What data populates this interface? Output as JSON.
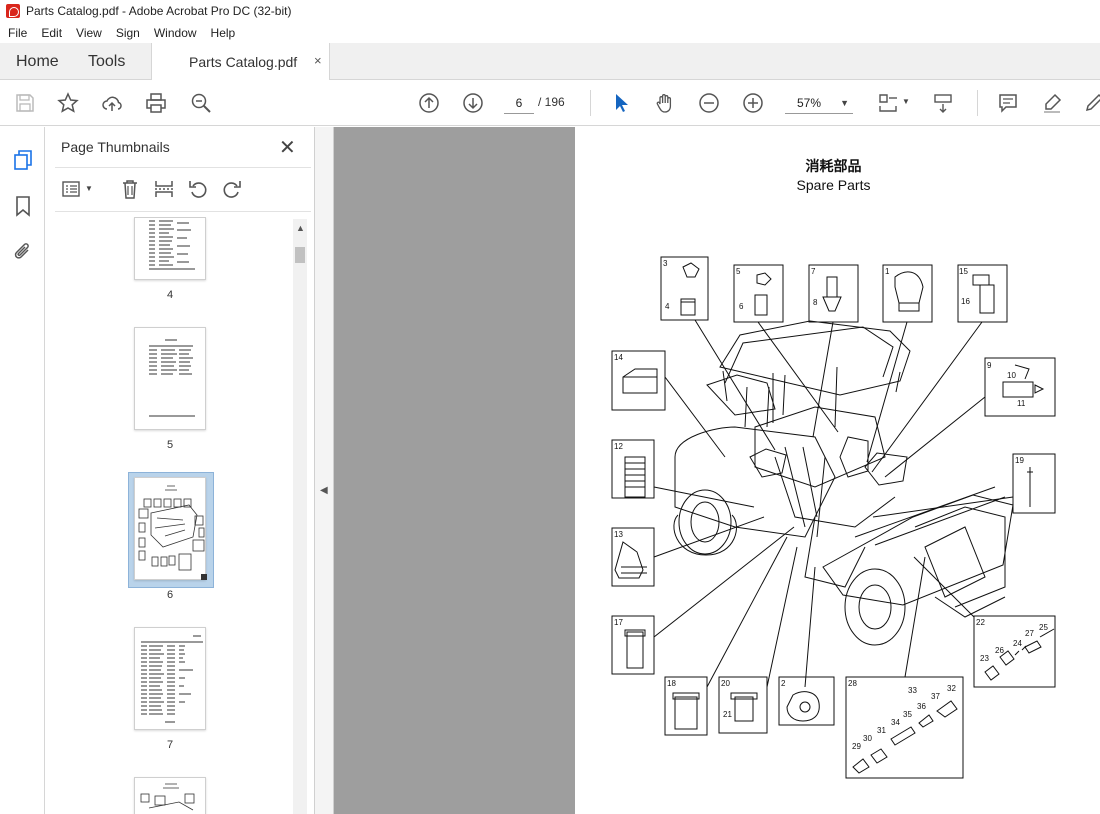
{
  "window": {
    "title": "Parts Catalog.pdf - Adobe Acrobat Pro DC (32-bit)"
  },
  "menu": [
    "File",
    "Edit",
    "View",
    "Sign",
    "Window",
    "Help"
  ],
  "tabs": {
    "home": "Home",
    "tools": "Tools",
    "document": "Parts Catalog.pdf",
    "close": "×"
  },
  "toolbar": {
    "page_current": "6",
    "page_total": "/ 196",
    "zoom": "57%",
    "icons": [
      "save-icon",
      "star-icon",
      "upload-icon",
      "print-icon",
      "zoom-search-icon",
      "page-up-icon",
      "page-down-icon",
      "select-cursor-icon",
      "hand-icon",
      "zoom-out-icon",
      "zoom-in-icon",
      "fit-page-icon",
      "scroll-mode-icon",
      "comment-icon",
      "highlight-icon",
      "draw-icon"
    ]
  },
  "sidebar": {
    "title": "Page Thumbnails",
    "close": "✕",
    "thumbnails": [
      {
        "label": "4"
      },
      {
        "label": "5"
      },
      {
        "label": "6",
        "selected": true
      },
      {
        "label": "7"
      }
    ]
  },
  "page": {
    "title_jp": "消耗部品",
    "title_en": "Spare Parts",
    "callouts": [
      "3",
      "4",
      "5",
      "6",
      "7",
      "8",
      "1",
      "15",
      "16",
      "14",
      "9",
      "10",
      "11",
      "12",
      "19",
      "13",
      "17",
      "18",
      "20",
      "21",
      "2",
      "22",
      "23",
      "24",
      "25",
      "26",
      "27",
      "28",
      "29",
      "30",
      "31",
      "32",
      "33",
      "34",
      "35",
      "36",
      "37"
    ]
  },
  "colors": {
    "accent": "#1a73e8",
    "select_cursor": "#1565c0",
    "doc_bg": "#9e9e9e",
    "thumb_selected": "#b9d3ea"
  }
}
